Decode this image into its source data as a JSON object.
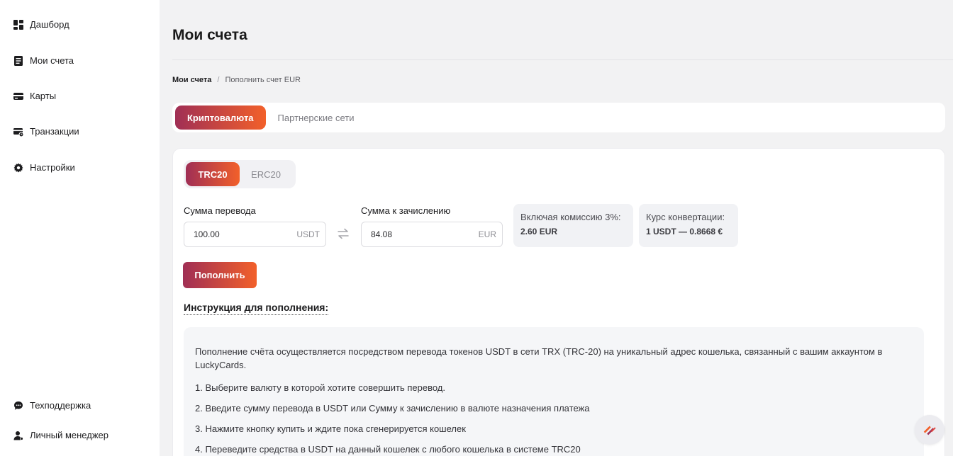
{
  "sidebar": {
    "top_items": [
      {
        "label": "Дашборд",
        "icon": "dashboard-icon"
      },
      {
        "label": "Мои счета",
        "icon": "accounts-icon"
      },
      {
        "label": "Карты",
        "icon": "card-icon"
      },
      {
        "label": "Транзакции",
        "icon": "transactions-icon"
      },
      {
        "label": "Настройки",
        "icon": "gear-icon"
      }
    ],
    "bottom_items": [
      {
        "label": "Техподдержка",
        "icon": "chat-icon"
      },
      {
        "label": "Личный менеджер",
        "icon": "manager-icon"
      }
    ]
  },
  "header": {
    "title": "Мои счета"
  },
  "breadcrumb": {
    "first": "Мои счета",
    "separator": "/",
    "current": "Пополнить счет EUR"
  },
  "tabs": [
    {
      "label": "Криптовалюта",
      "active": true
    },
    {
      "label": "Партнерские сети",
      "active": false
    }
  ],
  "network_tabs": [
    {
      "label": "TRC20",
      "active": true
    },
    {
      "label": "ERC20",
      "active": false
    }
  ],
  "form": {
    "send_label": "Сумма перевода",
    "send_value": "100.00",
    "send_unit": "USDT",
    "receive_label": "Сумма к зачислению",
    "receive_value": "84.08",
    "receive_unit": "EUR",
    "commission_label": "Включая комиссию 3%:",
    "commission_value": "2.60 EUR",
    "rate_label": "Курс конвертации:",
    "rate_value": "1 USDT — 0.8668 €",
    "submit_label": "Пополнить"
  },
  "instructions": {
    "title": "Инструкция для пополнения:",
    "intro": "Пополнение счёта осуществляется посредством перевода токенов USDT в сети TRX (TRC-20) на уникальный адрес кошелька, связанный с вашим аккаунтом в LuckyCards.",
    "steps": [
      "1. Выберите валюту в которой хотите совершить перевод.",
      "2. Введите сумму перевода в USDT или Сумму к зачислению в валюте назначения платежа",
      "3. Нажмите кнопку купить и ждите пока сгенерируется кошелек",
      "4. Переведите средства в USDT на данный кошелек с любого кошелька в системе TRC20"
    ]
  },
  "colors": {
    "accent_start": "#a02f55",
    "accent_end": "#f2602a",
    "page_bg": "#f2f2f3",
    "panel_bg": "#ffffff"
  }
}
